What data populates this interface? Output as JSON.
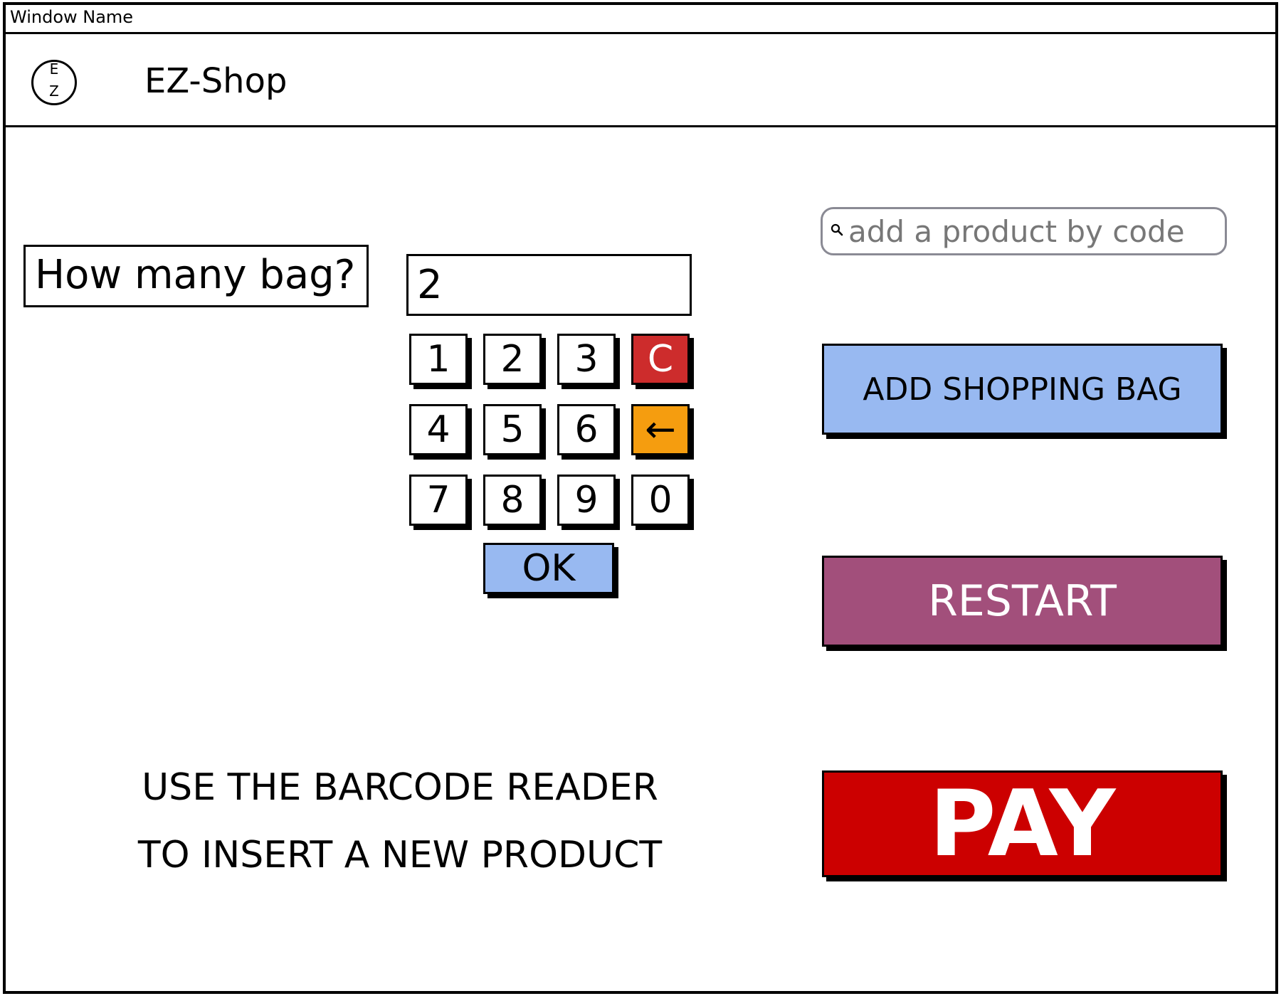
{
  "window": {
    "title": "Window Name"
  },
  "header": {
    "logo_top": "E",
    "logo_bottom": "Z",
    "app_title": "EZ-Shop"
  },
  "bag_prompt": {
    "label": "How many bag?",
    "value": "2"
  },
  "keypad": {
    "keys": [
      "1",
      "2",
      "3",
      "C",
      "4",
      "5",
      "6",
      "←",
      "7",
      "8",
      "9",
      "0"
    ],
    "ok_label": "OK"
  },
  "search": {
    "placeholder": "add a product by code"
  },
  "actions": {
    "add_bag": "ADD SHOPPING BAG",
    "restart": "RESTART",
    "pay": "PAY"
  },
  "instructions": {
    "line1": "USE THE BARCODE READER",
    "line2": "TO INSERT A NEW PRODUCT"
  },
  "colors": {
    "clear_key": "#cd2c2c",
    "backspace_key": "#f59d0f",
    "ok_key": "#98b9f1",
    "add_bag_button": "#98b9f1",
    "restart_button": "#a24f7b",
    "pay_button": "#cc0000"
  },
  "icons": {
    "search": "search-icon",
    "backspace": "backspace-arrow-icon",
    "logo": "ez-logo-icon"
  }
}
